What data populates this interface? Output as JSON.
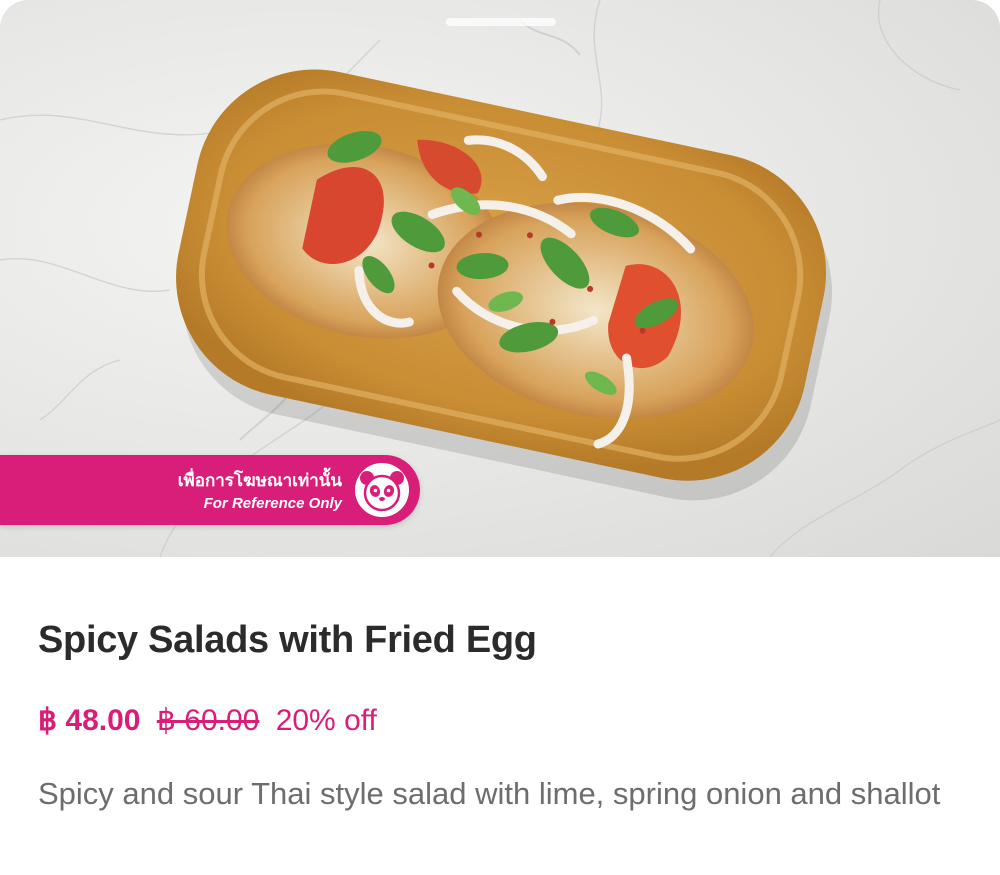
{
  "badge": {
    "thai_label": "เพื่อการโฆษณาเท่านั้น",
    "english_label": "For Reference Only",
    "icon": "foodpanda-panda-icon"
  },
  "item": {
    "title": "Spicy Salads with Fried Egg",
    "price": "฿ 48.00",
    "original_price": "฿ 60.00",
    "discount": "20% off",
    "description": "Spicy and sour Thai style salad with lime, spring onion and shallot"
  },
  "colors": {
    "brand_pink": "#d91e7a",
    "title_text": "#2b2b2b",
    "description_text": "#6d6d6d"
  }
}
